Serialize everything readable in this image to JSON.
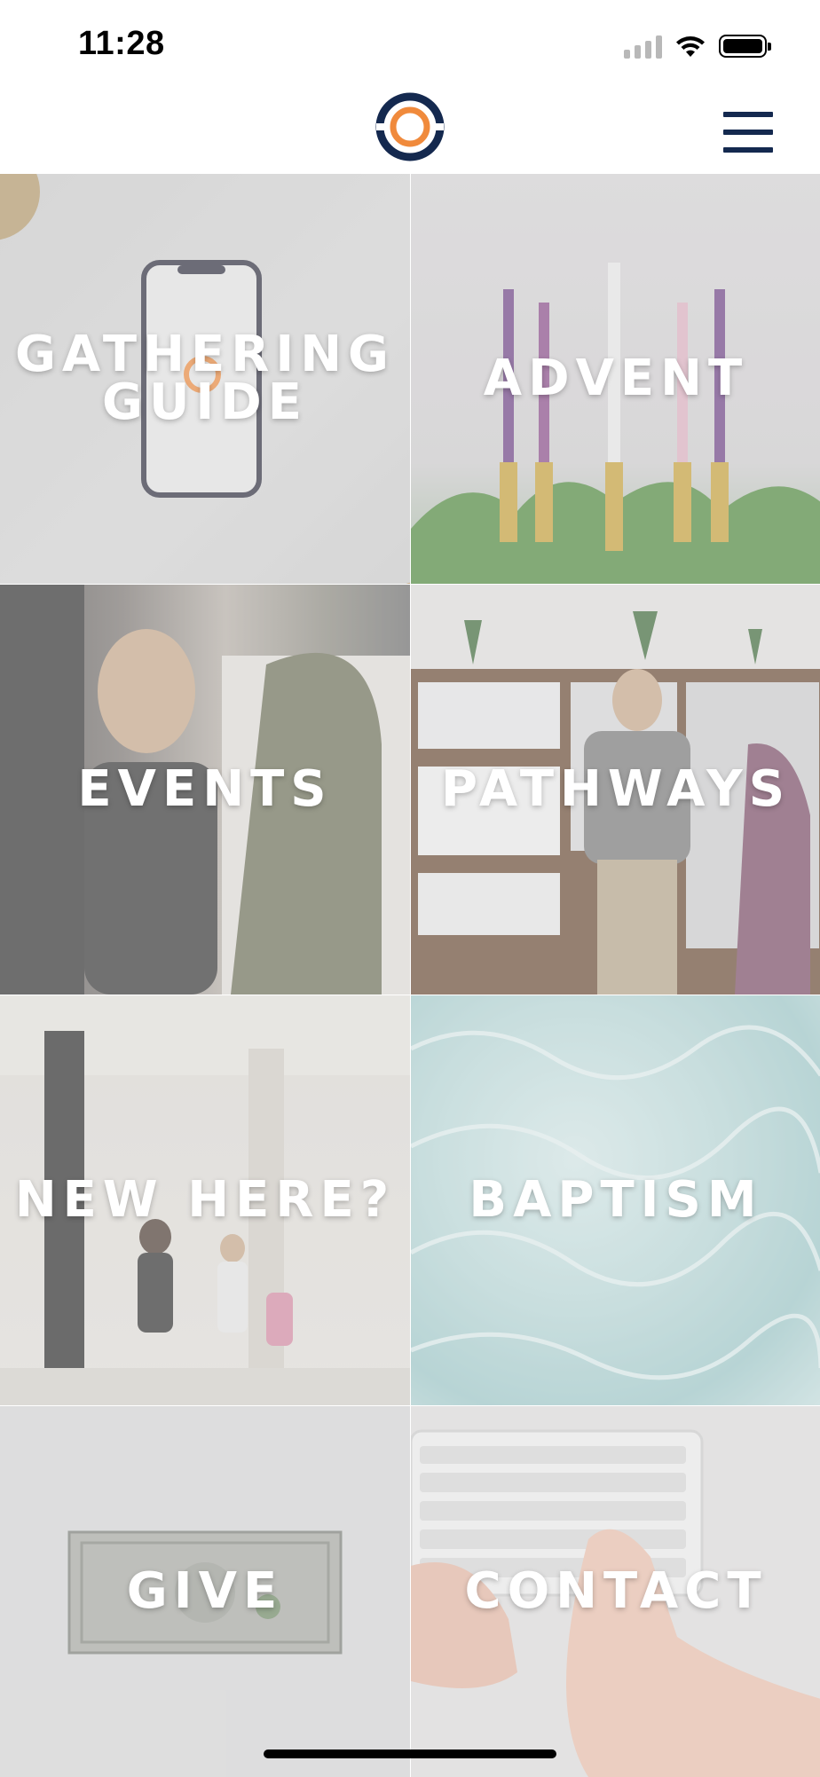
{
  "status_bar": {
    "time": "11:28",
    "icons": [
      "cellular-signal-icon",
      "wifi-icon",
      "battery-icon"
    ]
  },
  "header": {
    "logo": "church-logo",
    "menu_icon": "hamburger-menu-icon",
    "colors": {
      "navy": "#14294f",
      "orange": "#f08a3c"
    }
  },
  "tiles": [
    {
      "id": "gathering-guide",
      "label_lines": [
        "GATHERING",
        "GUIDE"
      ],
      "background": "phone-on-desk-photo"
    },
    {
      "id": "advent",
      "label_lines": [
        "ADVENT"
      ],
      "background": "advent-candles-photo"
    },
    {
      "id": "events",
      "label_lines": [
        "EVENTS"
      ],
      "background": "people-gathering-photo"
    },
    {
      "id": "pathways",
      "label_lines": [
        "PATHWAYS"
      ],
      "background": "bookstore-shelves-photo"
    },
    {
      "id": "new-here",
      "label_lines": [
        "NEW HERE?"
      ],
      "background": "church-entrance-photo"
    },
    {
      "id": "baptism",
      "label_lines": [
        "BAPTISM"
      ],
      "background": "water-surface-photo"
    },
    {
      "id": "give",
      "label_lines": [
        "GIVE"
      ],
      "background": "dollar-bill-photo"
    },
    {
      "id": "contact",
      "label_lines": [
        "CONTACT"
      ],
      "background": "keyboard-typing-photo"
    }
  ]
}
